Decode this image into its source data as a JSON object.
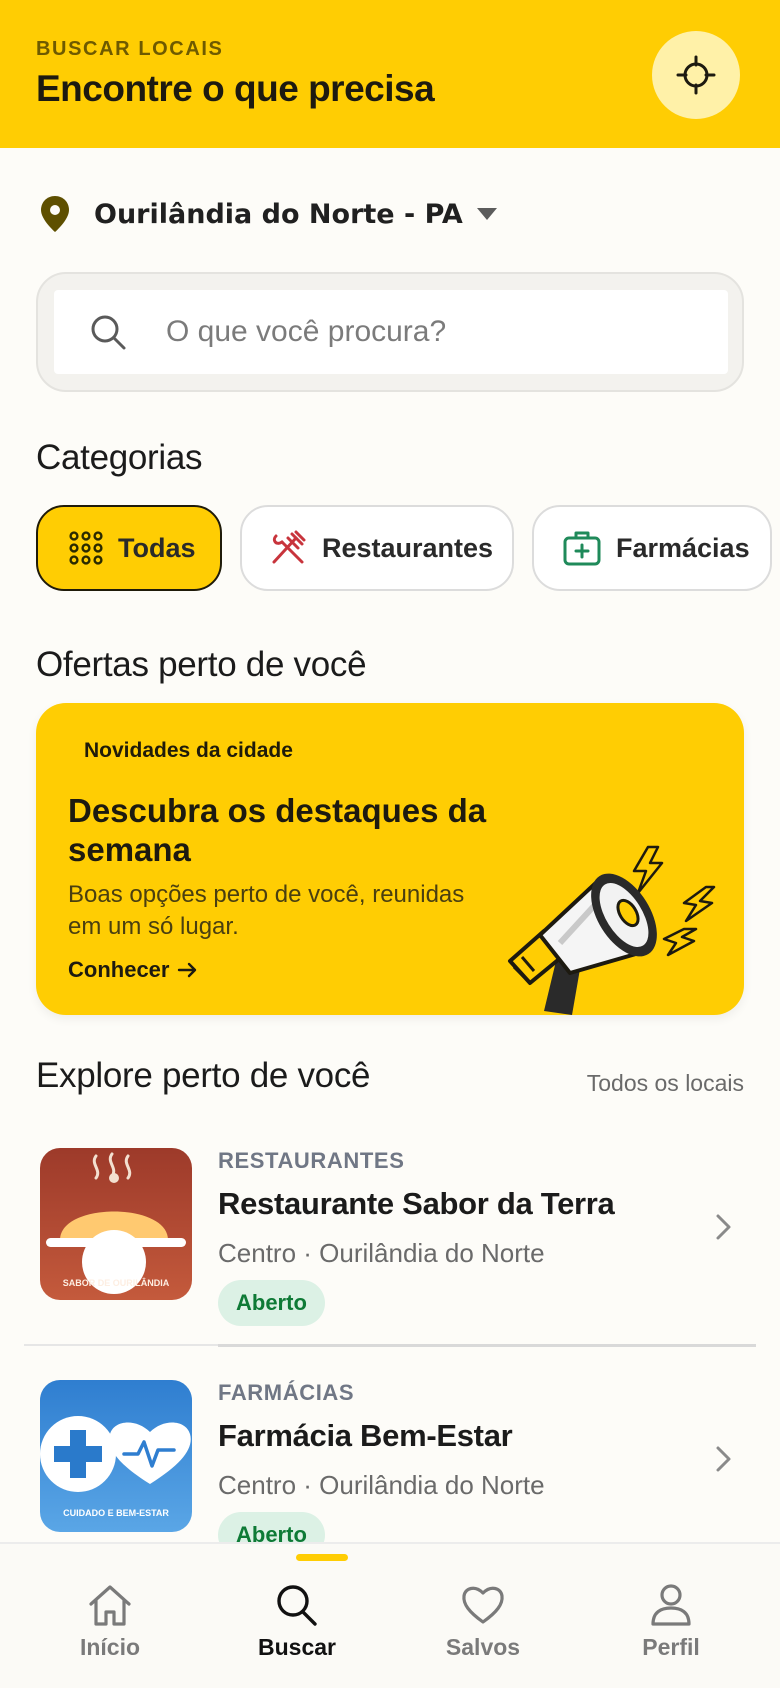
{
  "header": {
    "eyebrow": "BUSCAR LOCAIS",
    "title": "Encontre o que precisa",
    "locate_icon": "crosshair-icon"
  },
  "location": {
    "label": "Ourilândia do Norte - PA",
    "icon": "map-pin-icon"
  },
  "search": {
    "placeholder": "O que você procura?",
    "value": ""
  },
  "categories": {
    "title": "Categorias",
    "items": [
      {
        "label": "Todas",
        "icon": "grid-dots-icon",
        "active": true
      },
      {
        "label": "Restaurantes",
        "icon": "fork-knife-icon",
        "active": false
      },
      {
        "label": "Farmácias",
        "icon": "medical-kit-icon",
        "active": false
      }
    ]
  },
  "offers": {
    "title": "Ofertas perto de você",
    "promo": {
      "eyebrow": "Novidades da cidade",
      "title": "Descubra os destaques da semana",
      "description": "Boas opções perto de você, reunidas em um só lugar.",
      "link": "Conhecer",
      "art": "megaphone-illustration"
    }
  },
  "explore": {
    "title": "Explore perto de você",
    "see_all": "Todos os locais",
    "places": [
      {
        "category": "RESTAURANTES",
        "name": "Restaurante Sabor da Terra",
        "location": "Centro · Ourilândia do Norte",
        "status": "Aberto",
        "thumb_text": "SABOR DE OURILÂNDIA"
      },
      {
        "category": "FARMÁCIAS",
        "name": "Farmácia Bem-Estar",
        "location": "Centro · Ourilândia do Norte",
        "status": "Aberto",
        "thumb_text": "CUIDADO E BEM-ESTAR"
      }
    ]
  },
  "nav": {
    "items": [
      {
        "label": "Início",
        "icon": "home-icon"
      },
      {
        "label": "Buscar",
        "icon": "search-icon",
        "active": true
      },
      {
        "label": "Salvos",
        "icon": "heart-icon"
      },
      {
        "label": "Perfil",
        "icon": "user-icon"
      }
    ]
  },
  "colors": {
    "brand": "#ffcd03",
    "open_badge_bg": "#dcf1e5",
    "open_badge_text": "#0e7a36",
    "restaurant_icon": "#c8343c",
    "pharmacy_icon": "#1f8a5a"
  }
}
